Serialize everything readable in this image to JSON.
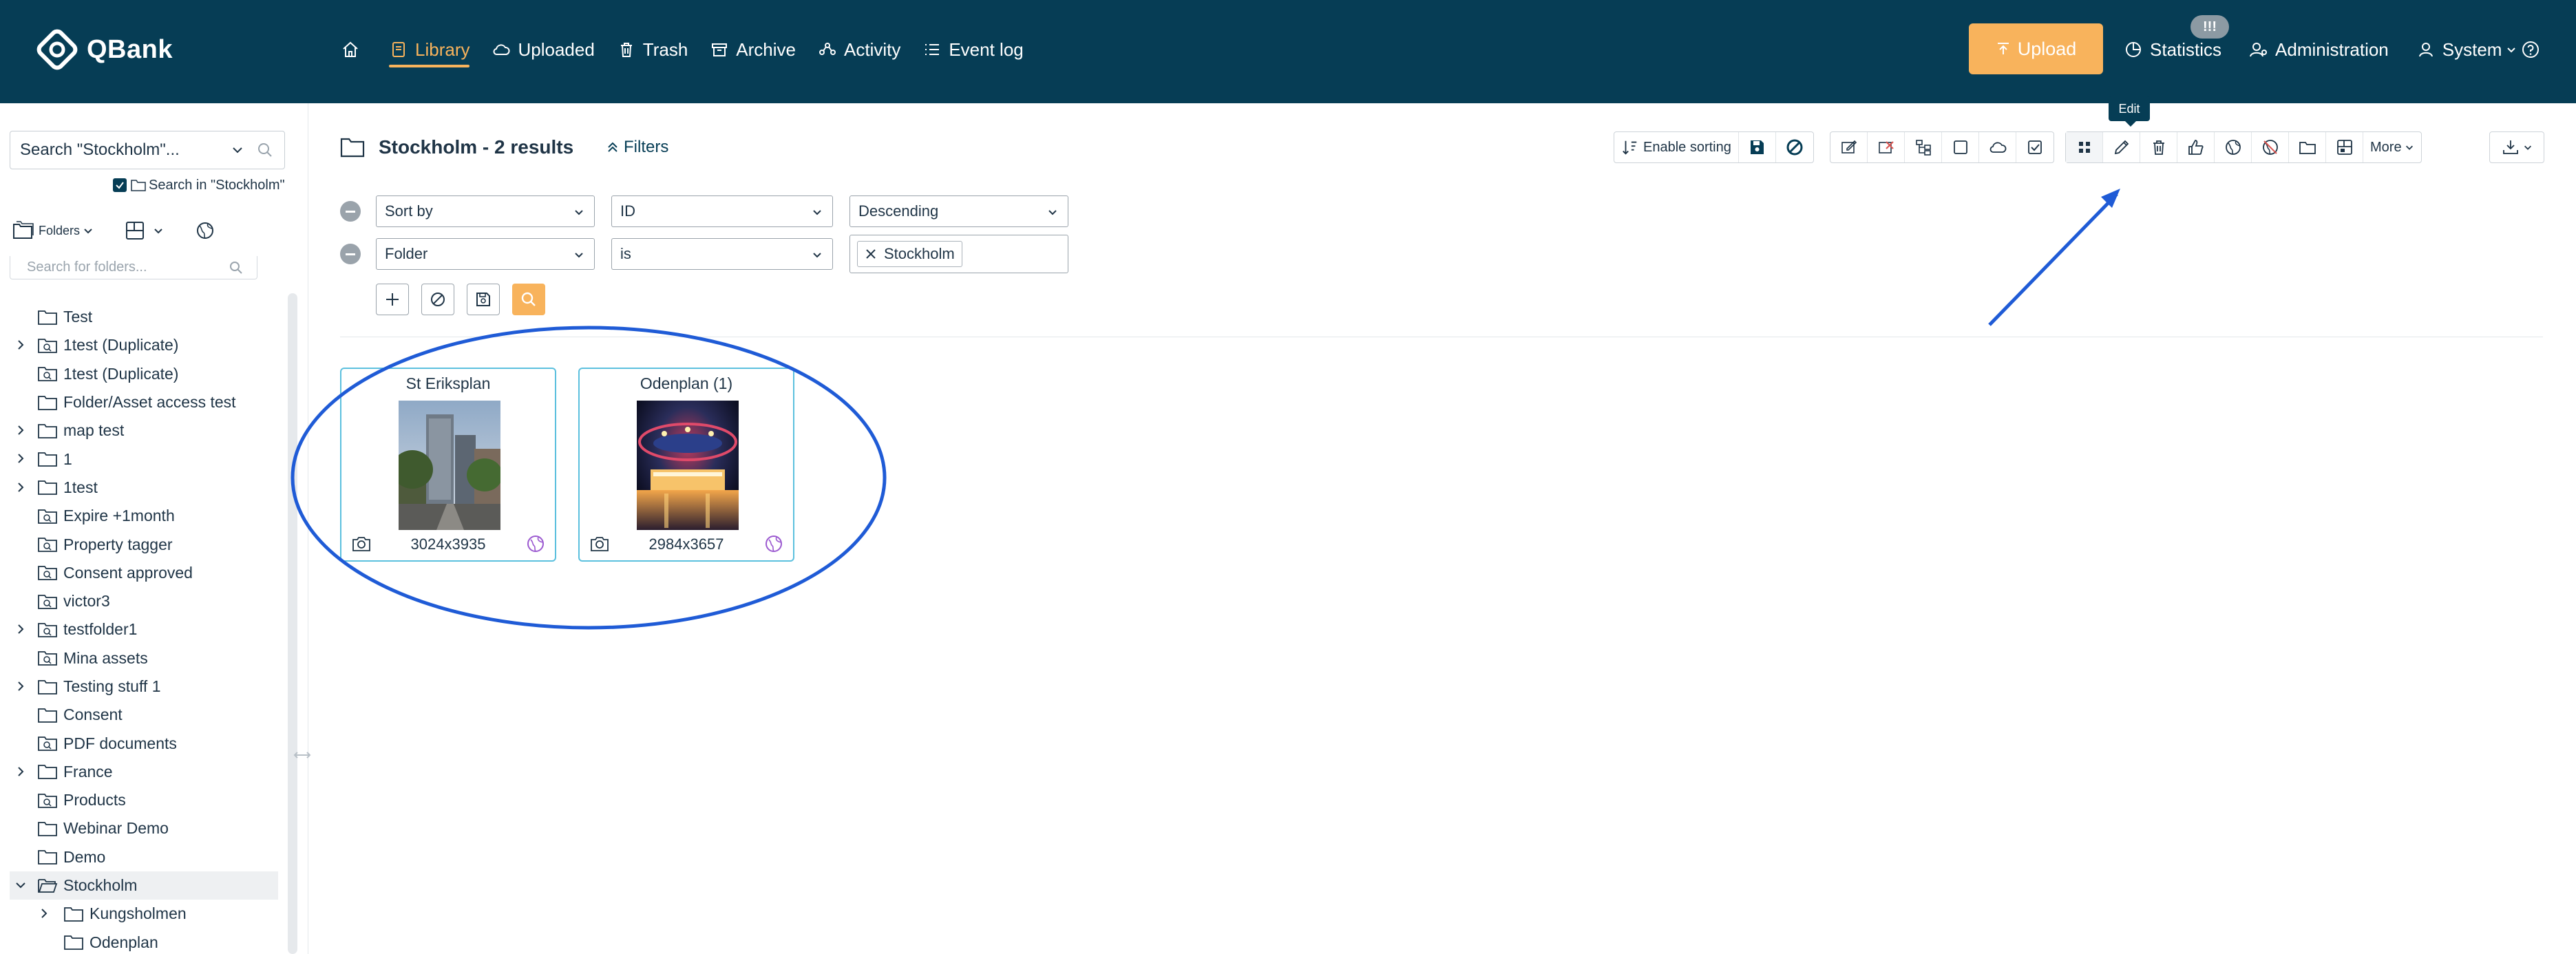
{
  "app": {
    "name": "QBank"
  },
  "nav": {
    "items": [
      {
        "label": "",
        "icon": "home-icon"
      },
      {
        "label": "Library",
        "icon": "library-icon"
      },
      {
        "label": "Uploaded",
        "icon": "cloud-icon"
      },
      {
        "label": "Trash",
        "icon": "trash-icon"
      },
      {
        "label": "Archive",
        "icon": "archive-icon"
      },
      {
        "label": "Activity",
        "icon": "activity-icon"
      },
      {
        "label": "Event log",
        "icon": "list-icon"
      }
    ],
    "upload_label": "Upload",
    "badge": "!!!",
    "statistics": "Statistics",
    "administration": "Administration",
    "system": "System"
  },
  "sidebar": {
    "search_value": "Search \"Stockholm\"...",
    "search_in_label": "Search in \"Stockholm\"",
    "folders_label": "Folders",
    "folder_search_placeholder": "Search for folders...",
    "tree": [
      {
        "label": "Test",
        "expandable": false,
        "smart": false
      },
      {
        "label": "1test (Duplicate)",
        "expandable": true,
        "smart": true
      },
      {
        "label": "1test (Duplicate)",
        "expandable": false,
        "smart": true
      },
      {
        "label": "Folder/Asset access test",
        "expandable": false,
        "smart": false
      },
      {
        "label": "map test",
        "expandable": true,
        "smart": false
      },
      {
        "label": "1",
        "expandable": true,
        "smart": false
      },
      {
        "label": "1test",
        "expandable": true,
        "smart": false
      },
      {
        "label": "Expire +1month",
        "expandable": false,
        "smart": true
      },
      {
        "label": "Property tagger",
        "expandable": false,
        "smart": true
      },
      {
        "label": "Consent approved",
        "expandable": false,
        "smart": true
      },
      {
        "label": "victor3",
        "expandable": false,
        "smart": true
      },
      {
        "label": "testfolder1",
        "expandable": true,
        "smart": true
      },
      {
        "label": "Mina assets",
        "expandable": false,
        "smart": true
      },
      {
        "label": "Testing stuff 1",
        "expandable": true,
        "smart": false
      },
      {
        "label": "Consent",
        "expandable": false,
        "smart": false
      },
      {
        "label": "PDF documents",
        "expandable": false,
        "smart": true
      },
      {
        "label": "France",
        "expandable": true,
        "smart": false
      },
      {
        "label": "Products",
        "expandable": false,
        "smart": true
      },
      {
        "label": "Webinar Demo",
        "expandable": false,
        "smart": false
      },
      {
        "label": "Demo",
        "expandable": false,
        "smart": false
      },
      {
        "label": "Stockholm",
        "expandable": true,
        "smart": false,
        "open": true,
        "selected": true
      },
      {
        "label": "Kungsholmen",
        "expandable": true,
        "smart": false,
        "child": true
      },
      {
        "label": "Odenplan",
        "expandable": false,
        "smart": false,
        "child": true
      }
    ]
  },
  "main": {
    "title": "Stockholm - 2 results",
    "filters_label": "Filters",
    "enable_sorting": "Enable sorting",
    "tooltip": "Edit",
    "more_label": "More",
    "sort_row": {
      "field": "Sort by",
      "value": "ID",
      "order": "Descending"
    },
    "filter_row": {
      "field": "Folder",
      "operator": "is",
      "tag": "Stockholm"
    },
    "cards": [
      {
        "title": "St Eriksplan",
        "dims": "3024x3935"
      },
      {
        "title": "Odenplan (1)",
        "dims": "2984x3657"
      }
    ]
  },
  "colors": {
    "topbar": "#063d55",
    "accent": "#f8b35c",
    "card_border": "#5bc0de",
    "annotation": "#1f5bd6"
  }
}
